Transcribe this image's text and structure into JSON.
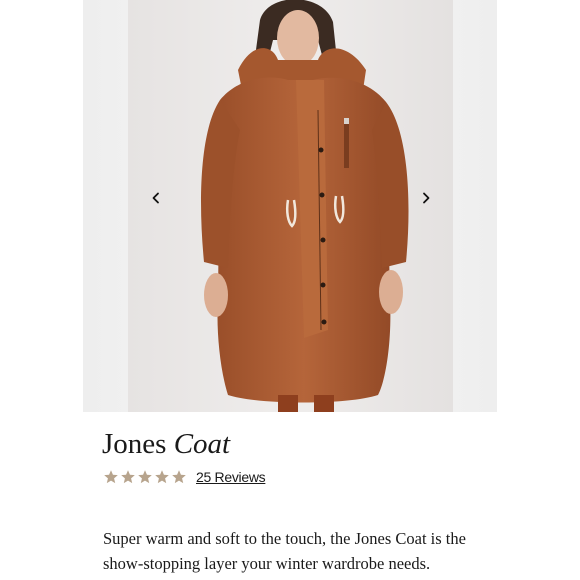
{
  "product": {
    "name_regular": "Jones",
    "name_italic": "Coat",
    "rating": 5,
    "rating_max": 5,
    "star_color": "#b7a48d",
    "reviews_label": "25 Reviews",
    "description": "Super warm and soft to the touch, the Jones Coat is the show-stopping layer your winter wardrobe needs."
  },
  "carousel": {
    "prev_icon": "chevron-left-icon",
    "next_icon": "chevron-right-icon",
    "image": "product-photo"
  }
}
